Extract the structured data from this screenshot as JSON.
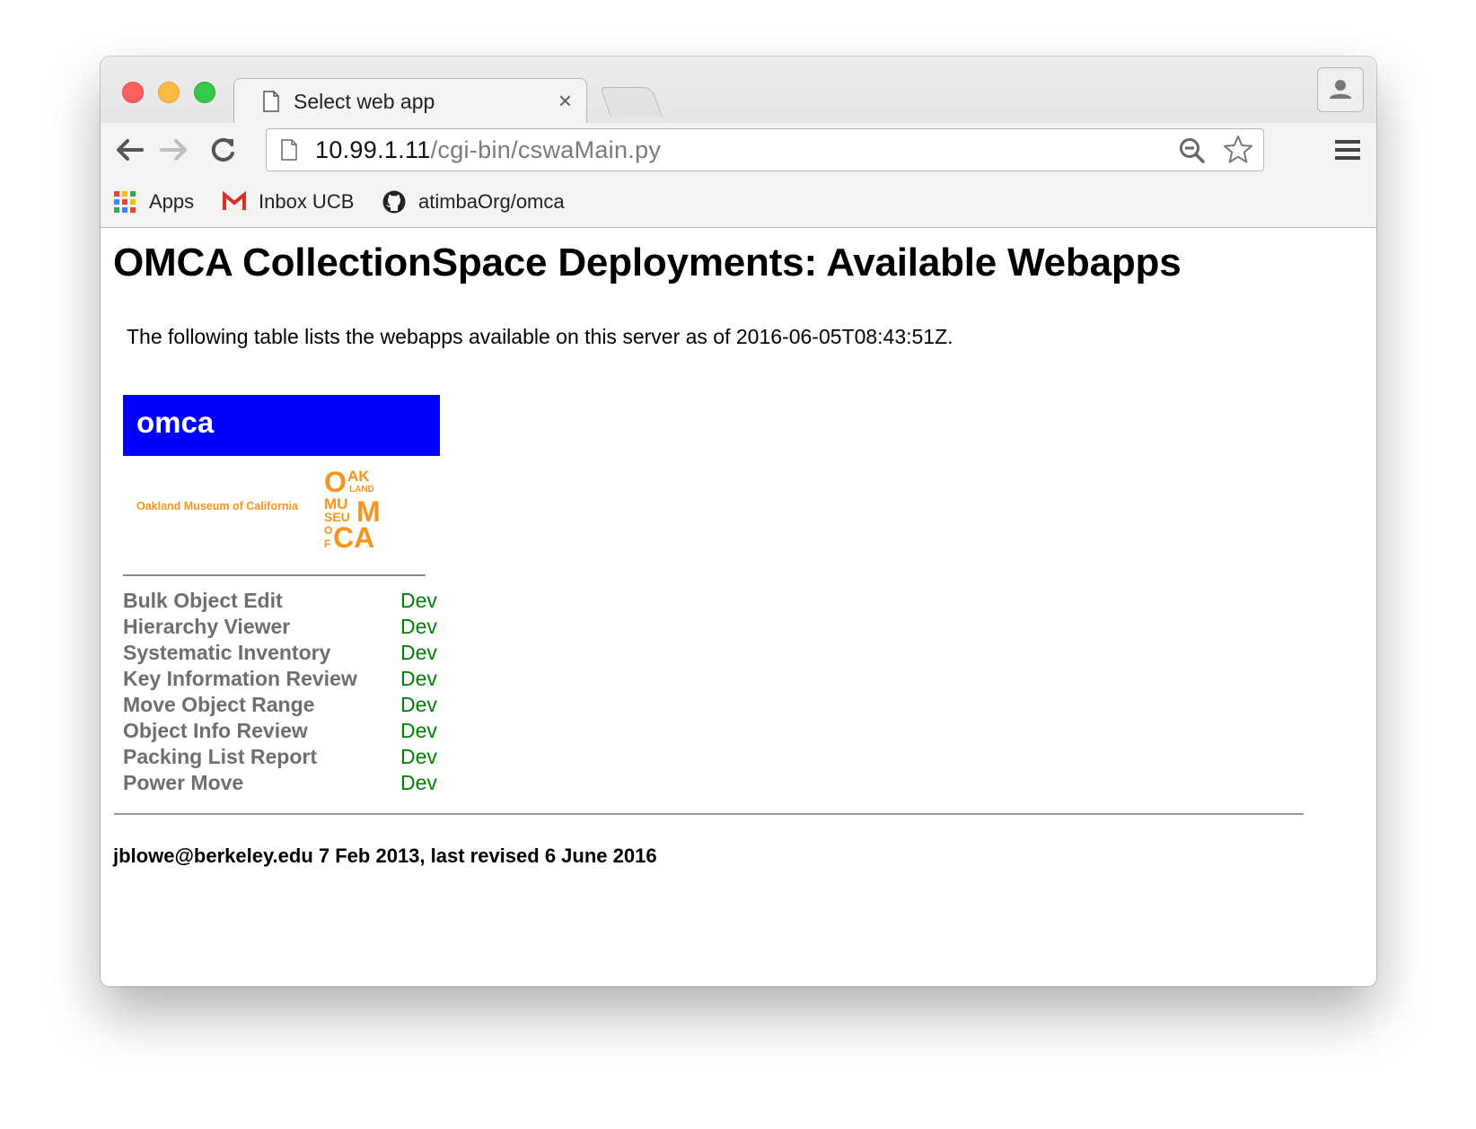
{
  "browser": {
    "tab_title": "Select web app",
    "tab_close": "×",
    "url_host": "10.99.1.11",
    "url_path": "/cgi-bin/cswaMain.py",
    "bookmarks": [
      {
        "label": "Apps",
        "icon": "apps-grid-icon"
      },
      {
        "label": "Inbox UCB",
        "icon": "gmail-icon"
      },
      {
        "label": "atimbaOrg/omca",
        "icon": "github-icon"
      }
    ]
  },
  "page": {
    "title": "OMCA CollectionSpace Deployments: Available Webapps",
    "intro": "The following table lists the webapps available on this server as of 2016-06-05T08:43:51Z.",
    "banner": "omca",
    "banner_color": "#0000ff",
    "logo_text": "Oakland Museum of California",
    "logo_mark_letters": [
      "O",
      "AK",
      "LAND",
      "MU",
      "SEU",
      "M",
      "O",
      "F",
      "CA"
    ],
    "logo_color": "#f7941d",
    "apps": [
      {
        "name": "Bulk Object Edit",
        "link": "Dev"
      },
      {
        "name": "Hierarchy Viewer",
        "link": "Dev"
      },
      {
        "name": "Systematic Inventory",
        "link": "Dev"
      },
      {
        "name": "Key Information Review",
        "link": "Dev"
      },
      {
        "name": "Move Object Range",
        "link": "Dev"
      },
      {
        "name": "Object Info Review",
        "link": "Dev"
      },
      {
        "name": "Packing List Report",
        "link": "Dev"
      },
      {
        "name": "Power Move",
        "link": "Dev"
      }
    ],
    "link_color": "#008000",
    "footer": "jblowe@berkeley.edu 7 Feb 2013, last revised 6 June 2016"
  }
}
